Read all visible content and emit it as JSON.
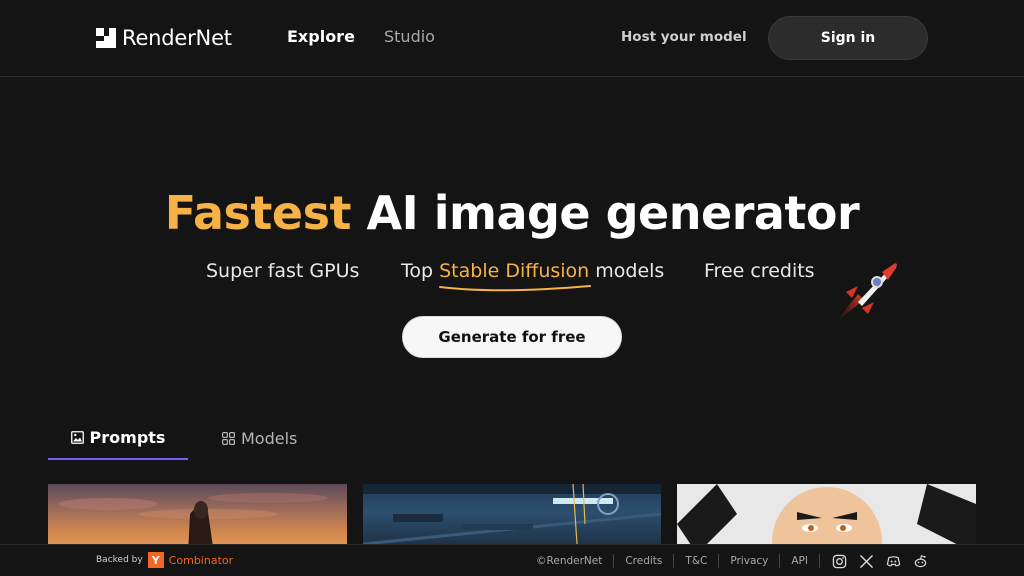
{
  "header": {
    "brand": "RenderNet",
    "nav": [
      {
        "label": "Explore",
        "active": true
      },
      {
        "label": "Studio",
        "active": false
      }
    ],
    "host_label": "Host your model",
    "signin_label": "Sign in"
  },
  "hero": {
    "title_accent": "Fastest",
    "title_rest": " AI image generator",
    "features": {
      "f1": "Super fast GPUs",
      "f2_prefix": "Top ",
      "f2_highlight": "Stable Diffusion",
      "f2_suffix": " models",
      "f3": "Free credits"
    },
    "cta_label": "Generate for free",
    "accent_color": "#f6b247"
  },
  "tabs": [
    {
      "label": "Prompts",
      "icon": "image-icon",
      "active": true
    },
    {
      "label": "Models",
      "icon": "grid-icon",
      "active": false
    }
  ],
  "footer": {
    "backed_label": "Backed by",
    "yc_letter": "Y",
    "yc_name": "Combinator",
    "copyright": "©RenderNet",
    "links": [
      "Credits",
      "T&C",
      "Privacy",
      "API"
    ],
    "social": [
      "instagram-icon",
      "x-icon",
      "discord-icon",
      "reddit-icon"
    ]
  },
  "colors": {
    "background": "#141414",
    "tab_indicator": "#7b5cf6",
    "yc_orange": "#f26522"
  }
}
